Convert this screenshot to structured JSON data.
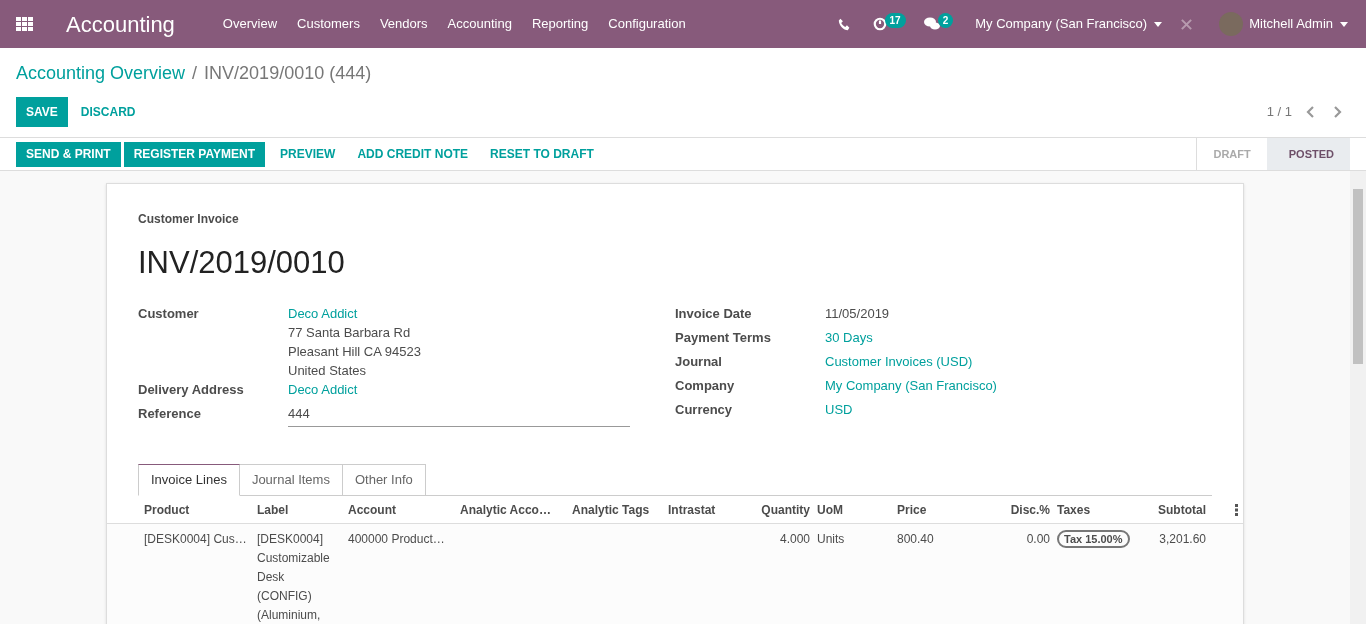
{
  "navbar": {
    "app_title": "Accounting",
    "menu": [
      "Overview",
      "Customers",
      "Vendors",
      "Accounting",
      "Reporting",
      "Configuration"
    ],
    "activity_count": "17",
    "message_count": "2",
    "company": "My Company (San Francisco)",
    "user": "Mitchell Admin"
  },
  "breadcrumb": [
    {
      "label": "Accounting Overview",
      "kind": "link"
    },
    {
      "label": "/",
      "kind": "separator"
    },
    {
      "label": "INV/2019/0010 (444)",
      "kind": "current"
    }
  ],
  "edit_buttons": [
    {
      "label": "SAVE",
      "kind": "primary"
    },
    {
      "label": "DISCARD",
      "kind": "link"
    }
  ],
  "pager": "1 / 1",
  "action_buttons": [
    {
      "label": "SEND & PRINT",
      "kind": "primary"
    },
    {
      "label": "REGISTER PAYMENT",
      "kind": "primary"
    },
    {
      "label": "PREVIEW",
      "kind": "link"
    },
    {
      "label": "ADD CREDIT NOTE",
      "kind": "link"
    },
    {
      "label": "RESET TO DRAFT",
      "kind": "link"
    }
  ],
  "status_stages": [
    {
      "label": "DRAFT",
      "selected": false
    },
    {
      "label": "POSTED",
      "selected": true
    }
  ],
  "sheet": {
    "subtitle": "Customer Invoice",
    "title": "INV/2019/0010",
    "left_fields": [
      {
        "label": "Customer",
        "kind": "link",
        "value": "Deco Addict",
        "lines": [
          "77 Santa Barbara Rd",
          "Pleasant Hill CA 94523",
          "United States"
        ]
      },
      {
        "label": "Delivery Address",
        "kind": "link",
        "value": "Deco Addict"
      },
      {
        "label": "Reference",
        "kind": "input",
        "value": "444"
      }
    ],
    "right_fields": [
      {
        "label": "Invoice Date",
        "kind": "text",
        "value": "11/05/2019"
      },
      {
        "label": "Payment Terms",
        "kind": "link",
        "value": "30 Days"
      },
      {
        "label": "Journal",
        "kind": "link",
        "value": "Customer Invoices (USD)"
      },
      {
        "label": "Company",
        "kind": "link",
        "value": "My Company (San Francisco)"
      },
      {
        "label": "Currency",
        "kind": "link",
        "value": "USD"
      }
    ],
    "tabs": [
      {
        "label": "Invoice Lines",
        "selected": true
      },
      {
        "label": "Journal Items",
        "selected": false
      },
      {
        "label": "Other Info",
        "selected": false
      }
    ],
    "table": {
      "columns": [
        "Product",
        "Label",
        "Account",
        "Analytic Acco…",
        "Analytic Tags",
        "Intrastat",
        "Quantity",
        "UoM",
        "Price",
        "Disc.%",
        "Taxes",
        "Subtotal"
      ],
      "rows": [
        {
          "product": "[DESK0004] Cus…",
          "label": "[DESK0004] Customizable Desk (CONFIG) (Aluminium,",
          "account": "400000 Product…",
          "quantity": "4.000",
          "uom": "Units",
          "price": "800.40",
          "discount": "0.00",
          "taxes": [
            "Tax 15.00%"
          ],
          "subtotal": "3,201.60"
        }
      ]
    }
  }
}
